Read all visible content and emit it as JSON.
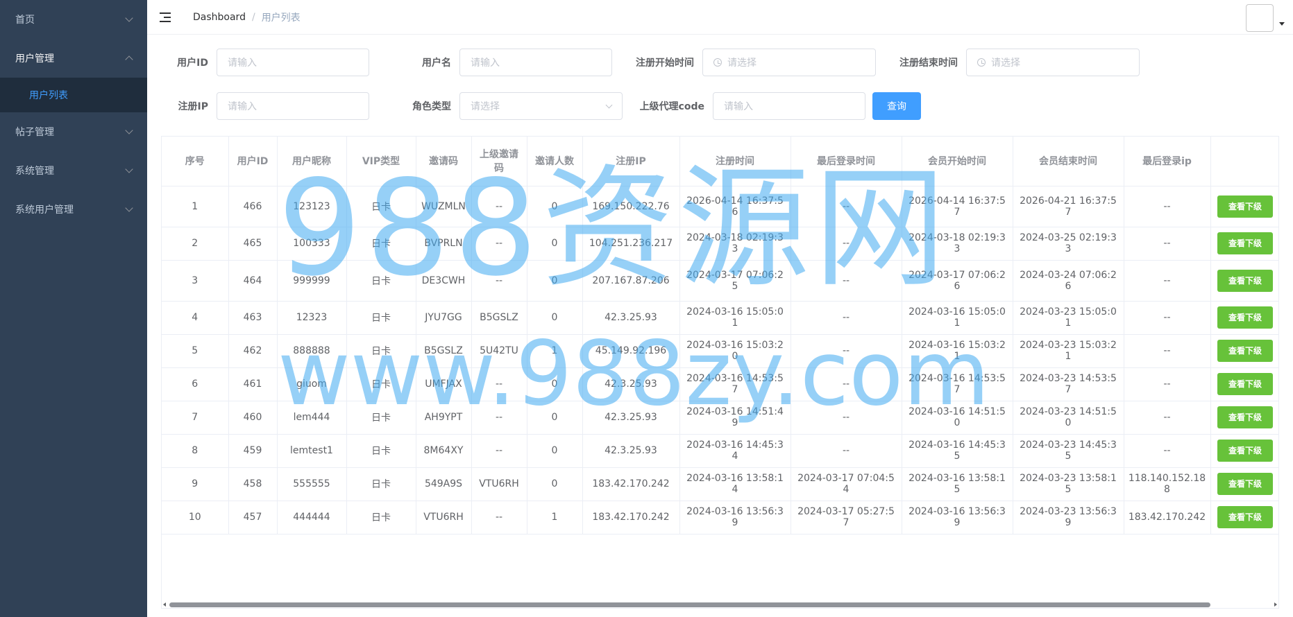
{
  "sidebar": {
    "items": [
      {
        "label": "首页",
        "expanded": false
      },
      {
        "label": "用户管理",
        "expanded": true
      },
      {
        "label": "用户列表",
        "active": true
      },
      {
        "label": "帖子管理",
        "expanded": false
      },
      {
        "label": "系统管理",
        "expanded": false
      },
      {
        "label": "系统用户管理",
        "expanded": false
      }
    ]
  },
  "navbar": {
    "breadcrumb_home": "Dashboard",
    "breadcrumb_sep": "/",
    "breadcrumb_current": "用户列表"
  },
  "filters": {
    "user_id": {
      "label": "用户ID",
      "placeholder": "请输入"
    },
    "username": {
      "label": "用户名",
      "placeholder": "请输入"
    },
    "reg_start": {
      "label": "注册开始时间",
      "placeholder": "请选择"
    },
    "reg_end": {
      "label": "注册结束时间",
      "placeholder": "请选择"
    },
    "reg_ip": {
      "label": "注册IP",
      "placeholder": "请输入"
    },
    "role": {
      "label": "角色类型",
      "placeholder": "请选择"
    },
    "agent_code": {
      "label": "上级代理code",
      "placeholder": "请输入"
    },
    "query_button": "查询"
  },
  "table": {
    "columns": [
      "序号",
      "用户ID",
      "用户昵称",
      "VIP类型",
      "邀请码",
      "上级邀请码",
      "邀请人数",
      "注册IP",
      "注册时间",
      "最后登录时间",
      "会员开始时间",
      "会员结束时间",
      "最后登录ip",
      ""
    ],
    "action_label": "查看下级",
    "rows": [
      [
        "1",
        "466",
        "123123",
        "日卡",
        "WUZMLN",
        "--",
        "0",
        "169.150.222.76",
        "2026-04-14 16:37:56",
        "--",
        "2026-04-14 16:37:57",
        "2026-04-21 16:37:57",
        "--"
      ],
      [
        "2",
        "465",
        "100333",
        "日卡",
        "BVPRLN",
        "--",
        "0",
        "104.251.236.217",
        "2024-03-18 02:19:33",
        "--",
        "2024-03-18 02:19:33",
        "2024-03-25 02:19:33",
        "--"
      ],
      [
        "3",
        "464",
        "999999",
        "日卡",
        "DE3CWH",
        "--",
        "0",
        "207.167.87.206",
        "2024-03-17 07:06:25",
        "--",
        "2024-03-17 07:06:26",
        "2024-03-24 07:06:26",
        "--"
      ],
      [
        "4",
        "463",
        "12323",
        "日卡",
        "JYU7GG",
        "B5GSLZ",
        "0",
        "42.3.25.93",
        "2024-03-16 15:05:01",
        "--",
        "2024-03-16 15:05:01",
        "2024-03-23 15:05:01",
        "--"
      ],
      [
        "5",
        "462",
        "888888",
        "日卡",
        "B5GSLZ",
        "5U42TU",
        "1",
        "45.149.92.196",
        "2024-03-16 15:03:20",
        "--",
        "2024-03-16 15:03:21",
        "2024-03-23 15:03:21",
        "--"
      ],
      [
        "6",
        "461",
        "giuom",
        "日卡",
        "UMFJAX",
        "--",
        "0",
        "42.3.25.93",
        "2024-03-16 14:53:57",
        "--",
        "2024-03-16 14:53:57",
        "2024-03-23 14:53:57",
        "--"
      ],
      [
        "7",
        "460",
        "lem444",
        "日卡",
        "AH9YPT",
        "--",
        "0",
        "42.3.25.93",
        "2024-03-16 14:51:49",
        "--",
        "2024-03-16 14:51:50",
        "2024-03-23 14:51:50",
        "--"
      ],
      [
        "8",
        "459",
        "lemtest1",
        "日卡",
        "8M64XY",
        "--",
        "0",
        "42.3.25.93",
        "2024-03-16 14:45:34",
        "--",
        "2024-03-16 14:45:35",
        "2024-03-23 14:45:35",
        "--"
      ],
      [
        "9",
        "458",
        "555555",
        "日卡",
        "549A9S",
        "VTU6RH",
        "0",
        "183.42.170.242",
        "2024-03-16 13:58:14",
        "2024-03-17 07:04:54",
        "2024-03-16 13:58:15",
        "2024-03-23 13:58:15",
        "118.140.152.188"
      ],
      [
        "10",
        "457",
        "444444",
        "日卡",
        "VTU6RH",
        "--",
        "1",
        "183.42.170.242",
        "2024-03-16 13:56:39",
        "2024-03-17 05:27:57",
        "2024-03-16 13:56:39",
        "2024-03-23 13:56:39",
        "183.42.170.242"
      ]
    ]
  },
  "watermark": {
    "line1": "988资源网",
    "line2": "www.988zy.com"
  },
  "colors": {
    "sidebar_bg": "#304156",
    "submenu_bg": "#1f2d3d",
    "primary": "#409eff",
    "success": "#67c23a",
    "watermark": "#40aaf0"
  }
}
